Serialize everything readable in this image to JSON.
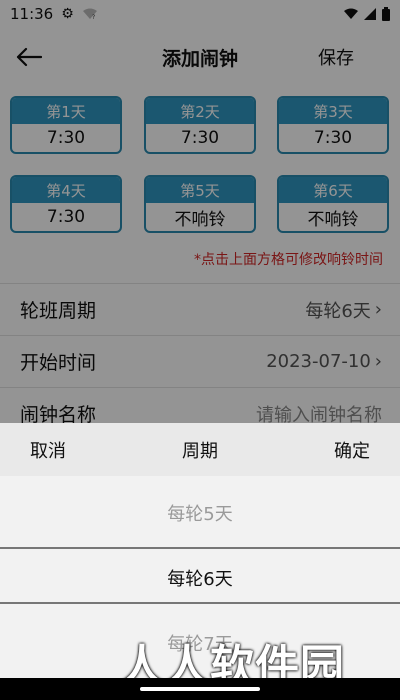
{
  "status_bar": {
    "time": "11:36",
    "gear_icon": "gear-icon",
    "wifi_question_icon": "wifi-question-icon",
    "wifi_icon": "wifi-icon",
    "signal_icon": "signal-icon",
    "battery_icon": "battery-icon"
  },
  "header": {
    "back_icon": "arrow-left-icon",
    "title": "添加闹钟",
    "save_label": "保存"
  },
  "days": [
    {
      "label": "第1天",
      "value": "7:30"
    },
    {
      "label": "第2天",
      "value": "7:30"
    },
    {
      "label": "第3天",
      "value": "7:30"
    },
    {
      "label": "第4天",
      "value": "7:30"
    },
    {
      "label": "第5天",
      "value": "不响铃"
    },
    {
      "label": "第6天",
      "value": "不响铃"
    }
  ],
  "hint": "*点击上面方格可修改响铃时间",
  "settings": {
    "cycle": {
      "label": "轮班周期",
      "value": "每轮6天"
    },
    "start": {
      "label": "开始时间",
      "value": "2023-07-10"
    },
    "name": {
      "label": "闹钟名称",
      "placeholder": "请输入闹钟名称"
    }
  },
  "picker": {
    "cancel": "取消",
    "title": "周期",
    "confirm": "确定",
    "options": [
      "每轮5天",
      "每轮6天",
      "每轮7天"
    ],
    "selected": "每轮6天"
  },
  "watermark": "人人软件园",
  "colors": {
    "accent": "#2f97c1",
    "hint_red": "#d32626"
  }
}
